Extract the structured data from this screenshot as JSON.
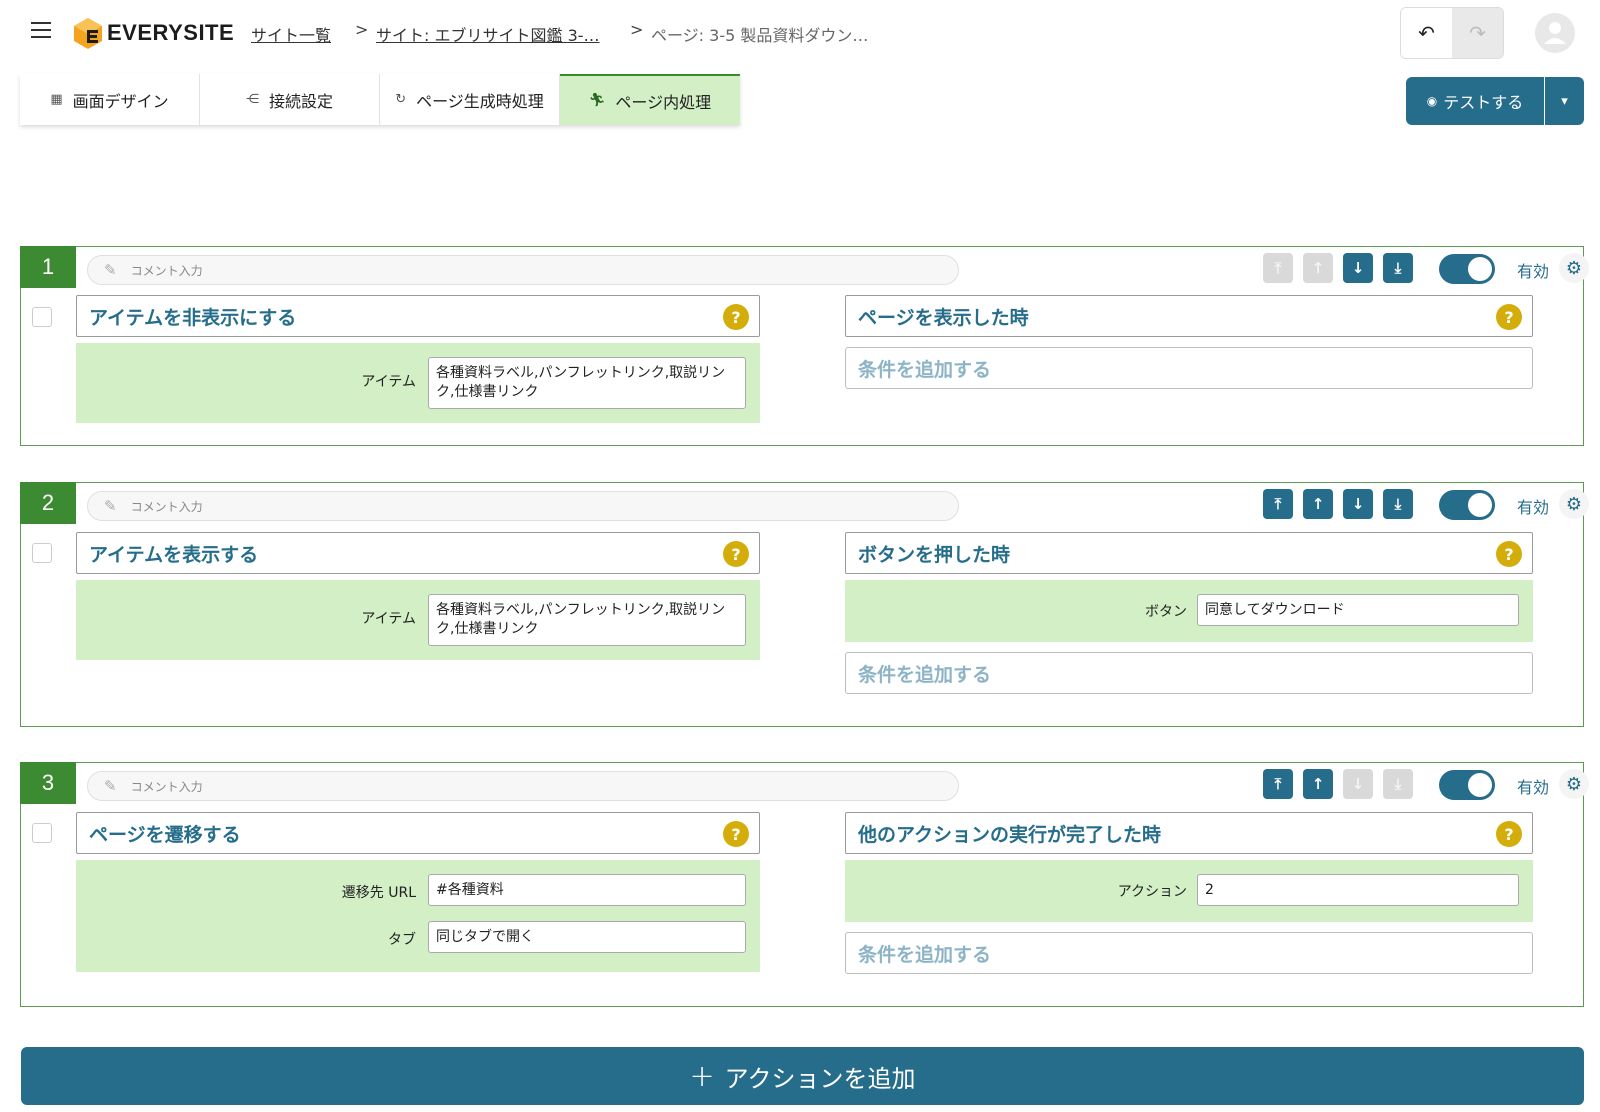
{
  "header": {
    "brand": "EVERYSITE",
    "breadcrumbs": [
      {
        "label": "サイト一覧"
      },
      {
        "label": "サイト: エブリサイト図鑑 3-…"
      },
      {
        "label": "ページ: 3-5 製品資料ダウン…"
      }
    ],
    "separator": ">",
    "undo_icon": "undo-icon",
    "redo_icon": "redo-icon"
  },
  "tabs": [
    {
      "label": "画面デザイン",
      "icon": "layout-icon"
    },
    {
      "label": "接続設定",
      "icon": "network-icon"
    },
    {
      "label": "ページ生成時処理",
      "icon": "refresh-icon"
    },
    {
      "label": "ページ内処理",
      "icon": "runner-icon"
    }
  ],
  "test_button": {
    "label": "テストする"
  },
  "comment_placeholder": "コメント入力",
  "enabled_label": "有効",
  "add_condition_label": "条件を追加する",
  "actions": [
    {
      "number": "1",
      "action_title": "アイテムを非表示にする",
      "action_params": [
        {
          "label": "アイテム",
          "value": "各種資料ラベル,パンフレットリンク,取説リンク,仕様書リンク"
        }
      ],
      "trigger_title": "ページを表示した時",
      "trigger_params": [],
      "enabled": true,
      "buttons": {
        "top": false,
        "up": false,
        "down": true,
        "bottom": true
      }
    },
    {
      "number": "2",
      "action_title": "アイテムを表示する",
      "action_params": [
        {
          "label": "アイテム",
          "value": "各種資料ラベル,パンフレットリンク,取説リンク,仕様書リンク"
        }
      ],
      "trigger_title": "ボタンを押した時",
      "trigger_params": [
        {
          "label": "ボタン",
          "value": "同意してダウンロード"
        }
      ],
      "enabled": true,
      "buttons": {
        "top": true,
        "up": true,
        "down": true,
        "bottom": true
      }
    },
    {
      "number": "3",
      "action_title": "ページを遷移する",
      "action_params": [
        {
          "label": "遷移先 URL",
          "value": "#各種資料"
        },
        {
          "label": "タブ",
          "value": "同じタブで開く"
        }
      ],
      "trigger_title": "他のアクションの実行が完了した時",
      "trigger_params": [
        {
          "label": "アクション",
          "value": "2"
        }
      ],
      "enabled": true,
      "buttons": {
        "top": true,
        "up": true,
        "down": false,
        "bottom": false
      }
    }
  ],
  "add_action_label": "アクションを追加",
  "colors": {
    "primary": "#266d8c",
    "green": "#3c8a31",
    "param_bg": "#d2efc6",
    "help": "#d4ad0b"
  }
}
